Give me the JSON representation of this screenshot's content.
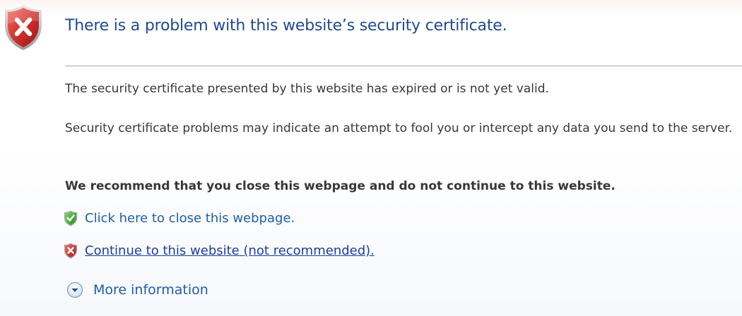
{
  "header": {
    "title": "There is a problem with this website’s security certificate.",
    "icon": "error-shield-icon"
  },
  "body": {
    "paragraph1": "The security certificate presented by this website has expired or is not yet valid.",
    "paragraph2": "Security certificate problems may indicate an attempt to fool you or intercept any data you send to the server.",
    "recommendation": "We recommend that you close this webpage and do not continue to this website."
  },
  "options": {
    "close": {
      "label": "Click here to close this webpage.",
      "icon": "green-check-shield-icon"
    },
    "continue": {
      "label": "Continue to this website (not recommended).",
      "icon": "red-x-shield-icon"
    }
  },
  "more_info": {
    "label": "More information",
    "icon": "chevron-down-circle-icon"
  },
  "colors": {
    "title": "#1f4b8e",
    "link": "#1e5ea8",
    "continue_link": "#1d3f9a",
    "body_text": "#383838",
    "error_red": "#c8262a",
    "safe_green": "#3d9b2f"
  }
}
